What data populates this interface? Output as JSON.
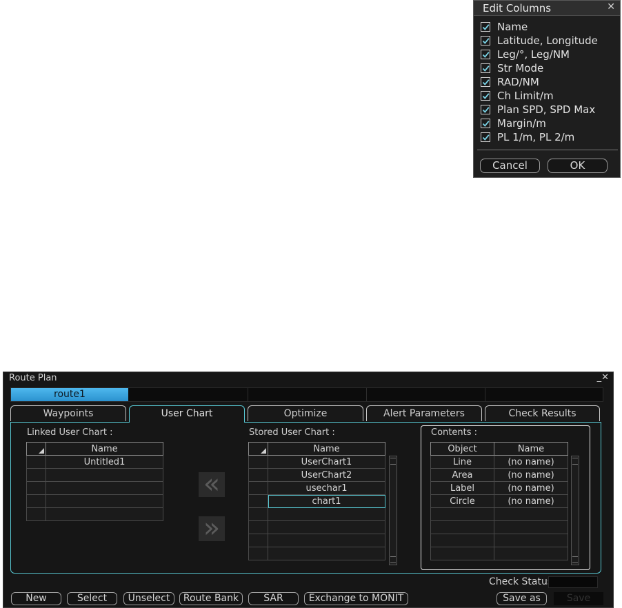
{
  "edit_columns": {
    "title": "Edit Columns",
    "close_glyph": "✕",
    "items": [
      {
        "label": "Name",
        "checked": true
      },
      {
        "label": "Latitude, Longitude",
        "checked": true
      },
      {
        "label": "Leg/°, Leg/NM",
        "checked": true
      },
      {
        "label": "Str Mode",
        "checked": true
      },
      {
        "label": "RAD/NM",
        "checked": true
      },
      {
        "label": "Ch Limit/m",
        "checked": true
      },
      {
        "label": "Plan SPD, SPD Max",
        "checked": true
      },
      {
        "label": "Margin/m",
        "checked": true
      },
      {
        "label": "PL 1/m, PL 2/m",
        "checked": true
      }
    ],
    "cancel_label": "Cancel",
    "ok_label": "OK"
  },
  "route_plan": {
    "title": "Route Plan",
    "window_controls": "_✕",
    "route_name": "route1",
    "tabs": [
      "Waypoints",
      "User Chart",
      "Optimize",
      "Alert Parameters",
      "Check Results"
    ],
    "active_tab": "User Chart",
    "linked": {
      "label": "Linked User Chart :",
      "header": "Name",
      "rows": [
        "Untitled1",
        "",
        "",
        "",
        ""
      ]
    },
    "stored": {
      "label": "Stored User Chart :",
      "header": "Name",
      "rows": [
        "UserChart1",
        "UserChart2",
        "usechar1",
        "chart1",
        "",
        "",
        "",
        ""
      ],
      "selected_row": "chart1"
    },
    "move_left_glyph": "«",
    "move_right_glyph": "»",
    "contents": {
      "label": "Contents :",
      "headers": [
        "Object",
        "Name"
      ],
      "rows": [
        [
          "Line",
          "(no name)"
        ],
        [
          "Area",
          "(no name)"
        ],
        [
          "Label",
          "(no name)"
        ],
        [
          "Circle",
          "(no name)"
        ],
        [
          "",
          ""
        ],
        [
          "",
          ""
        ],
        [
          "",
          ""
        ],
        [
          "",
          ""
        ]
      ]
    },
    "check_status_label": "Check Status:",
    "buttons": {
      "new": "New",
      "select": "Select",
      "unselect": "Unselect",
      "route_bank": "Route Bank",
      "sar": "SAR",
      "exchange": "Exchange to MONIT",
      "save_as": "Save as",
      "save": "Save"
    }
  },
  "colors": {
    "accent_cyan": "#58c9d4",
    "route_tab_blue": "#3aa6df",
    "window_bg": "#161616"
  }
}
